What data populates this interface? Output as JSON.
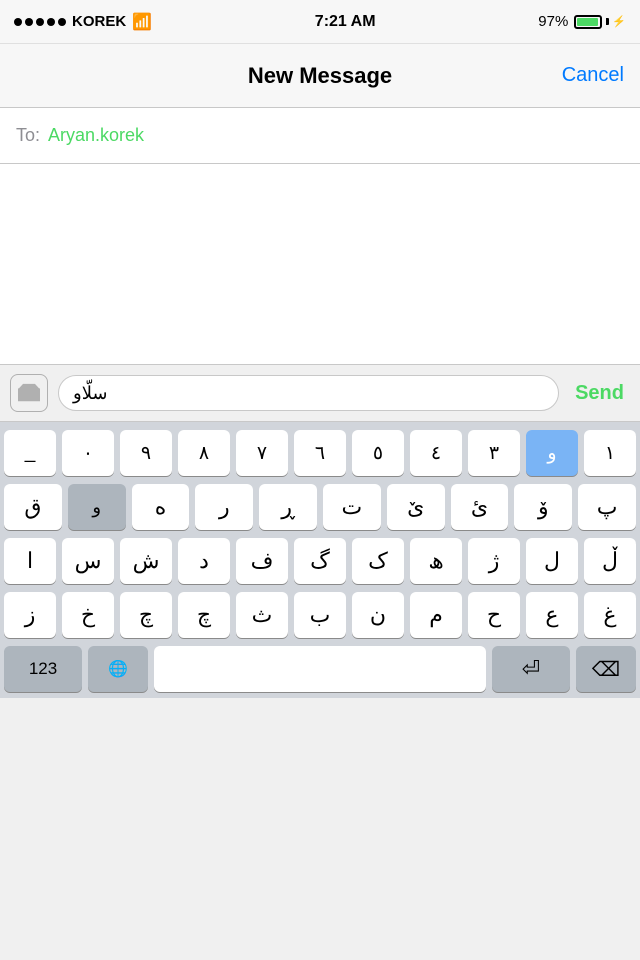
{
  "statusBar": {
    "carrier": "KOREK",
    "time": "7:21 AM",
    "battery": "97%",
    "batteryFillPercent": 95
  },
  "header": {
    "title": "New Message",
    "cancelLabel": "Cancel"
  },
  "toField": {
    "label": "To:",
    "contact": "Aryan.korek"
  },
  "inputArea": {
    "messageText": "سلّاو",
    "sendLabel": "Send"
  },
  "keyboard": {
    "row1": [
      "_",
      "٠",
      "٩",
      "٨",
      "٧",
      "٦",
      "٥",
      "٤",
      "٣",
      "و",
      "١"
    ],
    "row1Active": "و",
    "row2": [
      "ق",
      "و",
      "ە",
      "ر",
      "ڕ",
      "ت",
      "ێ",
      "ئ",
      "ۆ",
      "پ"
    ],
    "row3": [
      "ا",
      "س",
      "ش",
      "د",
      "ف",
      "گ",
      "ک",
      "ھ",
      "ژ",
      "ل",
      "ڵ"
    ],
    "row4": [
      "ز",
      "خ",
      "چ",
      "چ",
      "ث",
      "ب",
      "ن",
      "م",
      "ح",
      "ع",
      "غ"
    ],
    "bottomRow": {
      "numbers": "123",
      "globe": "🌐",
      "space": "",
      "return": "↵",
      "delete": "⌫"
    }
  }
}
